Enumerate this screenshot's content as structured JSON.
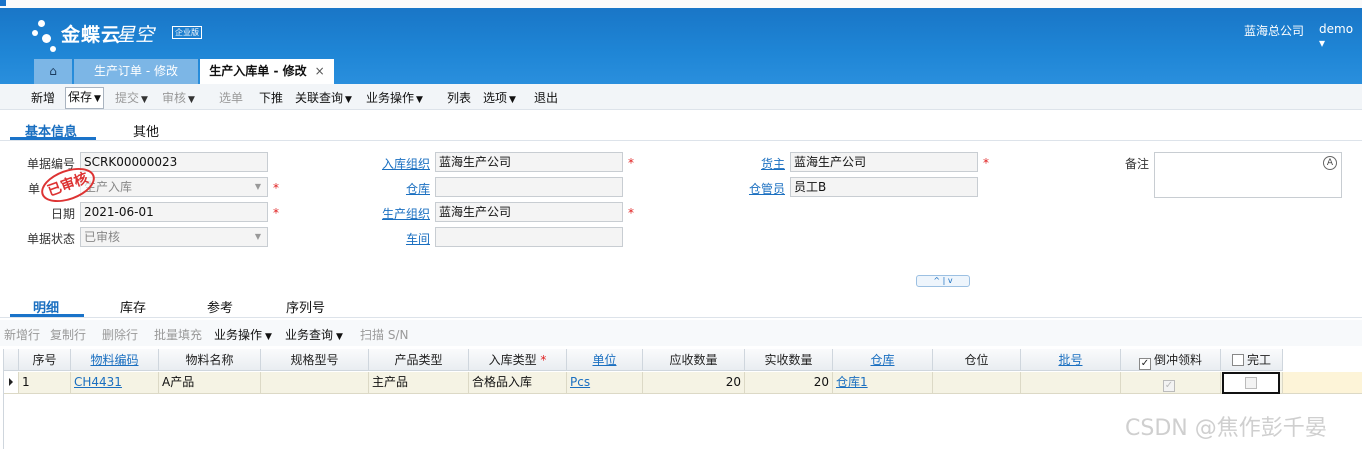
{
  "header": {
    "brand": "金蝶云",
    "brand_sub": "星空",
    "edition": "企业版",
    "company": "蓝海总公司",
    "user": "demo ▾"
  },
  "tabs": [
    {
      "label": "⌂",
      "icon": "home-icon"
    },
    {
      "label": "生产订单 - 修改"
    },
    {
      "label": "生产入库单 - 修改",
      "close": "×"
    }
  ],
  "toolbar": {
    "new": "新增",
    "save": "保存",
    "submit": "提交",
    "audit": "审核",
    "select": "选单",
    "push": "下推",
    "related": "关联查询",
    "business": "业务操作",
    "list": "列表",
    "options": "选项",
    "exit": "退出",
    "arrow": "▼"
  },
  "form_tabs": [
    "基本信息",
    "其他"
  ],
  "form": {
    "bill_no_label": "单据编号",
    "bill_no": "SCRK00000023",
    "bill_type_label": "单",
    "bill_type": "生产入库",
    "date_label": "日期",
    "date": "2021-06-01",
    "status_label": "单据状态",
    "status": "已审核",
    "in_org_label": "入库组织",
    "in_org": "蓝海生产公司",
    "warehouse_label": "仓库",
    "warehouse": "",
    "prod_org_label": "生产组织",
    "prod_org": "蓝海生产公司",
    "workshop_label": "车间",
    "workshop": "",
    "owner_label": "货主",
    "owner": "蓝海生产公司",
    "keeper_label": "仓管员",
    "keeper": "员工B",
    "note_label": "备注",
    "note": "",
    "required_mark": "*",
    "stamp": "已审核"
  },
  "collapse_label": "^ | v",
  "detail_tabs": [
    "明细",
    "库存",
    "参考",
    "序列号"
  ],
  "grid_toolbar": {
    "add_row": "新增行",
    "copy_row": "复制行",
    "delete_row": "删除行",
    "batch_fill": "批量填充",
    "business": "业务操作",
    "query": "业务查询",
    "scan": "扫描 S/N"
  },
  "grid": {
    "columns": [
      "序号",
      "物料编码",
      "物料名称",
      "规格型号",
      "产品类型",
      "入库类型",
      "单位",
      "应收数量",
      "实收数量",
      "仓库",
      "仓位",
      "批号",
      "倒冲领料",
      "完工"
    ],
    "required_mark": "*",
    "rows": [
      {
        "seq": "1",
        "material_code": "CH4431",
        "material_name": "A产品",
        "spec": "",
        "product_type": "主产品",
        "in_type": "合格品入库",
        "unit": "Pcs",
        "qty_due": "20",
        "qty_real": "20",
        "warehouse": "仓库1",
        "location": "",
        "lot": "",
        "backflush": "✓",
        "completed": ""
      }
    ]
  },
  "watermark": "CSDN @焦作彭千晏"
}
